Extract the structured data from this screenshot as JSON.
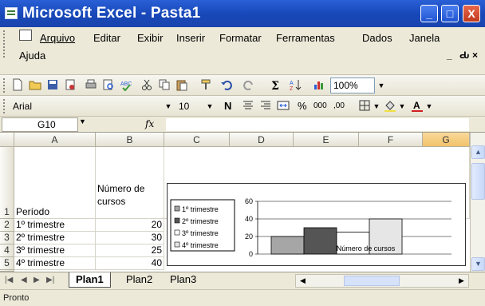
{
  "window": {
    "title": "Microsoft Excel - Pasta1",
    "minimize": "_",
    "maximize": "□",
    "close": "X"
  },
  "menu": {
    "items": [
      "Arquivo",
      "Editar",
      "Exibir",
      "Inserir",
      "Formatar",
      "Ferramentas",
      "Dados",
      "Janela",
      "Ajuda"
    ],
    "controls": [
      "_",
      "Ԃ",
      "×"
    ]
  },
  "toolbar": {
    "zoom": "100%"
  },
  "format_toolbar": {
    "font": "Arial",
    "size": "10",
    "bold": "N",
    "percent": "%",
    "thousands": "000",
    "decimals": ",00"
  },
  "formula_bar": {
    "name_box": "G10",
    "fx": "fx"
  },
  "columns": [
    "A",
    "B",
    "C",
    "D",
    "E",
    "F",
    "G"
  ],
  "rows": [
    "1",
    "2",
    "3",
    "4",
    "5"
  ],
  "cells": {
    "a1": "Período",
    "b1_line1": "Número de",
    "b1_line2": "cursos",
    "data": [
      {
        "periodo": "1º trimestre",
        "cursos": "20"
      },
      {
        "periodo": "2º trimestre",
        "cursos": "30"
      },
      {
        "periodo": "3º trimestre",
        "cursos": "25"
      },
      {
        "periodo": "4º trimestre",
        "cursos": "40"
      }
    ]
  },
  "chart_data": {
    "type": "bar",
    "xlabel": "Número de cursos",
    "ylim": [
      0,
      60
    ],
    "yticks": [
      "60",
      "40",
      "20",
      "0"
    ],
    "legend_placement": "left",
    "series": [
      {
        "name": "1º trimestre",
        "values": [
          20
        ],
        "color": "#a6a6a6"
      },
      {
        "name": "2º trimestre",
        "values": [
          30
        ],
        "color": "#555555"
      },
      {
        "name": "3º trimestre",
        "values": [
          25
        ],
        "color": "#ffffff"
      },
      {
        "name": "4º trimestre",
        "values": [
          40
        ],
        "color": "#e6e6e6"
      }
    ]
  },
  "sheets": {
    "tabs": [
      "Plan1",
      "Plan2",
      "Plan3"
    ],
    "active": "Plan1"
  },
  "status": "Pronto"
}
